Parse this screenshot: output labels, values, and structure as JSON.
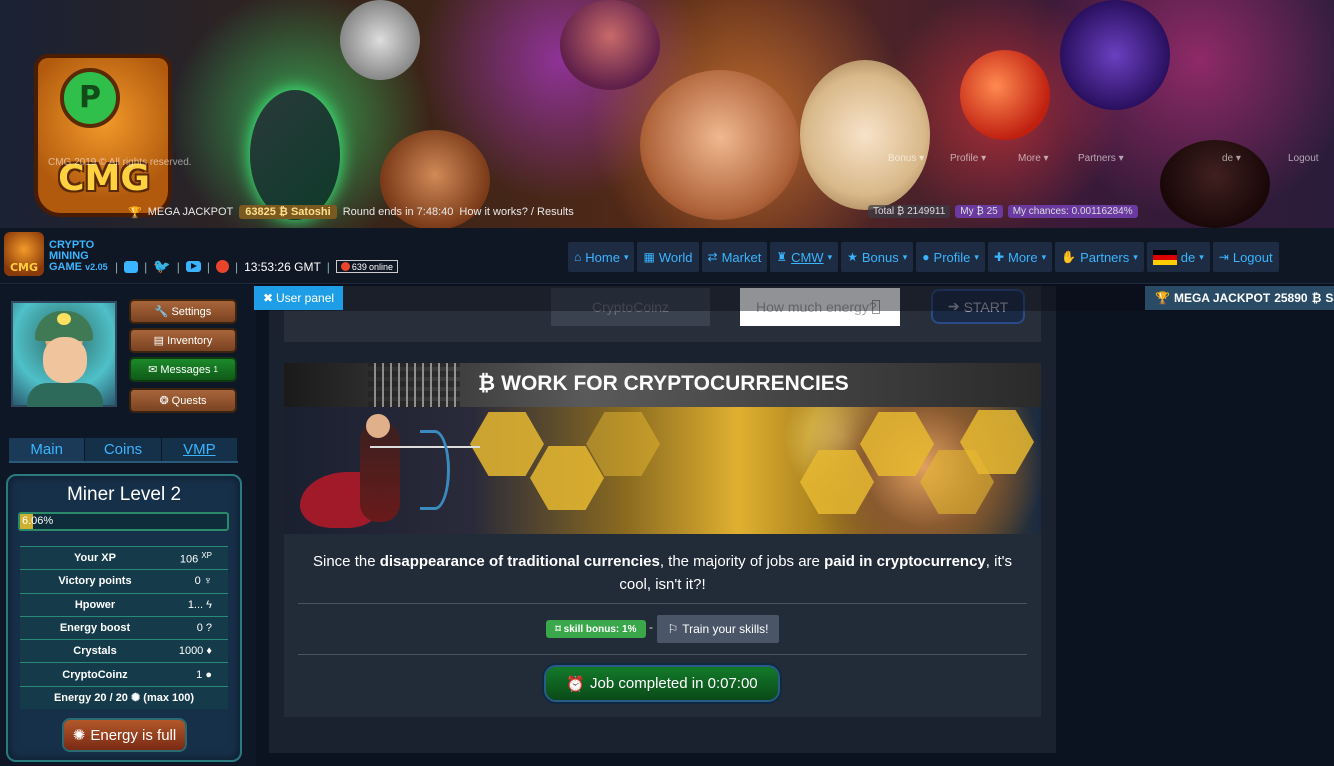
{
  "banner": {
    "logo_text": "CMG",
    "logo_coin": "P",
    "ghost_left": "CMG 2019 © All rights reserved.",
    "ghost_menu": [
      "Bonus ▾",
      "Profile ▾",
      "More ▾",
      "Partners ▾",
      "de ▾",
      "Logout"
    ],
    "mega_jackpot_label": "MEGA JACKPOT",
    "mega_jackpot_amount": "63825 ₿ Satoshi",
    "round_ends": "Round ends in 7:48:40",
    "how_it_works": "How it works? / Results",
    "total": "Total ₿ 2149911",
    "my": "My ₿ 25",
    "my_chances": "My chances: 0.00116284%"
  },
  "brand": {
    "logo_text": "CMG",
    "line1": "CRYPTO",
    "line2": "MINING",
    "line3": "GAME",
    "version": "v2.05",
    "time": "13:53:26 GMT",
    "online_count": "639",
    "online_label": "online",
    "separator": "|"
  },
  "nav": {
    "home": "Home",
    "world": "World",
    "market": "Market",
    "cmw": "CMW",
    "bonus": "Bonus",
    "profile": "Profile",
    "more": "More",
    "partners": "Partners",
    "lang": "de",
    "logout": "Logout",
    "caret": "▾"
  },
  "subbar": {
    "user_panel": "User panel",
    "mega_label": "MEGA JACKPOT",
    "mega_value": "25890",
    "mega_unit": "Sat."
  },
  "sidebar": {
    "settings": "Settings",
    "inventory": "Inventory",
    "messages": "Messages",
    "messages_count": "1",
    "quests": "Quests",
    "tabs": [
      "Main",
      "Coins",
      "VMP"
    ],
    "miner_title": "Miner Level 2",
    "progress_text": "6.06%",
    "progress_value": 0.0606,
    "stats": [
      {
        "key": "Your XP",
        "value": "106",
        "unit": "XP"
      },
      {
        "key": "Victory points",
        "value": "0",
        "unit": ""
      },
      {
        "key": "Hpower",
        "value": "1...",
        "unit": ""
      },
      {
        "key": "Energy boost",
        "value": "0",
        "unit": ""
      },
      {
        "key": "Crystals",
        "value": "1000",
        "unit": ""
      },
      {
        "key": "CryptoCoinz",
        "value": "1",
        "unit": ""
      }
    ],
    "energy_line": "Energy 20 / 20",
    "energy_max": "(max 100)",
    "energy_button": "Energy is full"
  },
  "toolbar": {
    "coin_select": "CryptoCoinz",
    "energy_placeholder": "How much energy?",
    "start": "START"
  },
  "work": {
    "title": "WORK FOR CRYPTOCURRENCIES",
    "desc_1": "Since the ",
    "desc_b1": "disappearance of traditional currencies",
    "desc_2": ", the majority of jobs are ",
    "desc_b2": "paid in cryptocurrency",
    "desc_3": ", it's cool, isn't it?!",
    "skill_bonus": "skill bonus: 1%",
    "dash": "-",
    "train": "Train your skills!",
    "job_completed": "Job completed in 0:07:00"
  },
  "colors": {
    "accent": "#3ab4ff",
    "user_panel": "#1e9ee6",
    "success": "#3aa84a",
    "job_button": "#137a2a",
    "progress_fill": "#d0b030"
  }
}
